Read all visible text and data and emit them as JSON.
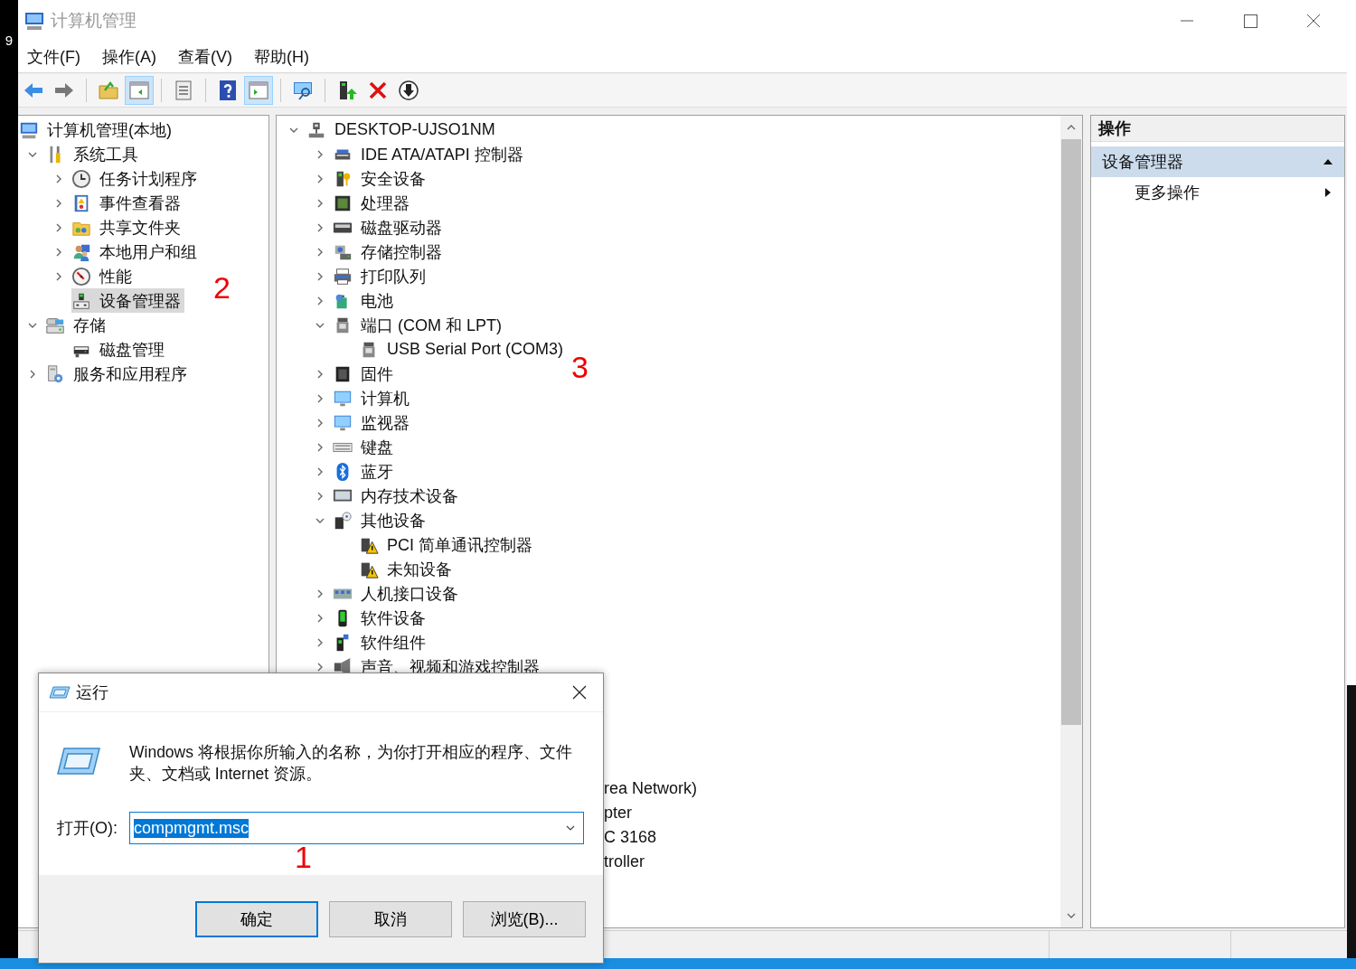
{
  "side_strip": {
    "label": "9"
  },
  "window": {
    "title": "计算机管理"
  },
  "menu": [
    "文件(F)",
    "操作(A)",
    "查看(V)",
    "帮助(H)"
  ],
  "toolbar": [
    {
      "selected": false
    },
    {
      "selected": false
    },
    {
      "selected": false
    },
    {
      "selected": true
    },
    {
      "selected": false
    },
    {
      "selected": false
    },
    {
      "selected": true
    },
    {
      "selected": false
    },
    {
      "selected": false
    },
    {
      "selected": false
    },
    {
      "selected": false
    }
  ],
  "console_tree": {
    "items": [
      {
        "label": "计算机管理(本地)",
        "selected": false,
        "children": [
          {
            "label": "系统工具",
            "expanded": true,
            "selected": false,
            "children": [
              {
                "label": "任务计划程序",
                "expanded": false,
                "selected": false
              },
              {
                "label": "事件查看器",
                "expanded": false,
                "selected": false
              },
              {
                "label": "共享文件夹",
                "expanded": false,
                "selected": false
              },
              {
                "label": "本地用户和组",
                "expanded": false,
                "selected": false
              },
              {
                "label": "性能",
                "expanded": false,
                "selected": false
              },
              {
                "label": "设备管理器",
                "selected": true
              }
            ]
          },
          {
            "label": "存储",
            "expanded": true,
            "selected": false,
            "children": [
              {
                "label": "磁盘管理",
                "selected": false
              }
            ]
          },
          {
            "label": "服务和应用程序",
            "expanded": false,
            "selected": false
          }
        ]
      }
    ]
  },
  "device_tree": {
    "items": [
      {
        "label": "DESKTOP-UJSO1NM",
        "expanded": true,
        "selected": false,
        "children": [
          {
            "label": "IDE ATA/ATAPI 控制器",
            "expanded": false,
            "selected": false
          },
          {
            "label": "安全设备",
            "expanded": false,
            "selected": false
          },
          {
            "label": "处理器",
            "expanded": false,
            "selected": false
          },
          {
            "label": "磁盘驱动器",
            "expanded": false,
            "selected": false
          },
          {
            "label": "存储控制器",
            "expanded": false,
            "selected": false
          },
          {
            "label": "打印队列",
            "expanded": false,
            "selected": false
          },
          {
            "label": "电池",
            "expanded": false,
            "selected": false
          },
          {
            "label": "端口 (COM 和 LPT)",
            "expanded": true,
            "selected": false,
            "children": [
              {
                "label": "USB Serial Port (COM3)",
                "selected": false
              }
            ]
          },
          {
            "label": "固件",
            "expanded": false,
            "selected": false
          },
          {
            "label": "计算机",
            "expanded": false,
            "selected": false
          },
          {
            "label": "监视器",
            "expanded": false,
            "selected": false
          },
          {
            "label": "键盘",
            "expanded": false,
            "selected": false
          },
          {
            "label": "蓝牙",
            "expanded": false,
            "selected": false
          },
          {
            "label": "内存技术设备",
            "expanded": false,
            "selected": false
          },
          {
            "label": "其他设备",
            "expanded": true,
            "selected": false,
            "children": [
              {
                "label": "PCI 简单通讯控制器",
                "selected": false
              },
              {
                "label": "未知设备",
                "selected": false
              }
            ]
          },
          {
            "label": "人机接口设备",
            "expanded": false,
            "selected": false
          },
          {
            "label": "软件设备",
            "expanded": false,
            "selected": false
          },
          {
            "label": "软件组件",
            "expanded": false,
            "selected": false
          },
          {
            "label": "声音、视频和游戏控制器",
            "expanded": false,
            "selected": false
          }
        ]
      }
    ],
    "partly_hidden_rows": [
      "rea Network)",
      "pter",
      "C 3168",
      "troller"
    ]
  },
  "actions_pane": {
    "title": "操作",
    "section": {
      "label": "设备管理器",
      "expanded": true
    },
    "items": [
      "更多操作"
    ]
  },
  "run_dialog": {
    "title": "运行",
    "description": "Windows 将根据你所输入的名称，为你打开相应的程序、文件夹、文档或 Internet 资源。",
    "open_label": "打开(O):",
    "command": {
      "value": "compmgmt.msc",
      "text_selected": true
    },
    "buttons": [
      {
        "label": "确定",
        "default": true
      },
      {
        "label": "取消",
        "default": false
      },
      {
        "label": "浏览(B)...",
        "default": false
      }
    ]
  },
  "annotations": [
    "2",
    "3",
    "1"
  ]
}
